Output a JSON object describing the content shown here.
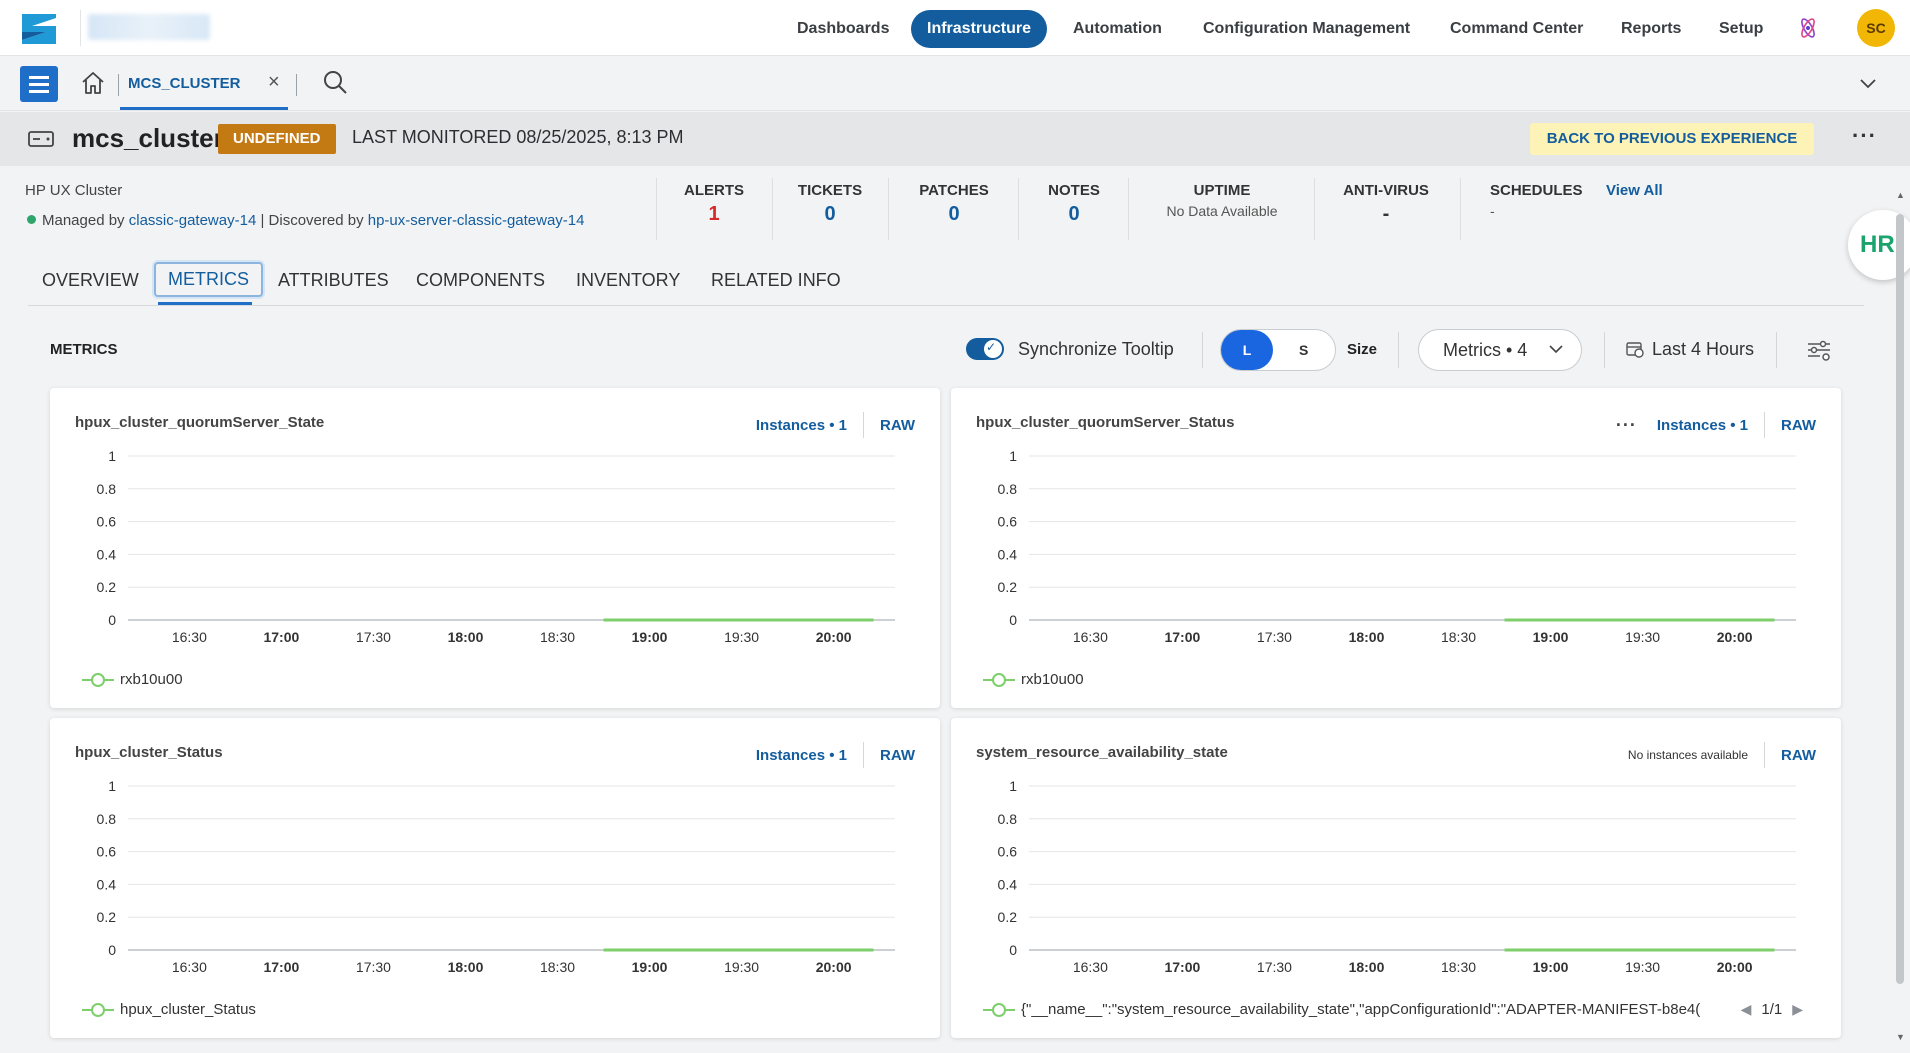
{
  "topnav": {
    "items": [
      {
        "label": "Dashboards"
      },
      {
        "label": "Infrastructure",
        "active": true
      },
      {
        "label": "Automation"
      },
      {
        "label": "Configuration Management"
      },
      {
        "label": "Command Center"
      },
      {
        "label": "Reports"
      },
      {
        "label": "Setup"
      }
    ],
    "avatar": "SC",
    "accent": "#135d9e"
  },
  "tabstrip": {
    "open_tab": "MCS_CLUSTER",
    "close_glyph": "×"
  },
  "header": {
    "title": "mcs_cluster",
    "badge": "UNDEFINED",
    "last_monitored": "LAST MONITORED 08/25/2025, 8:13 PM",
    "back_button": "BACK TO PREVIOUS EXPERIENCE",
    "kebab": "···"
  },
  "summary": {
    "device_type": "HP UX Cluster",
    "managed_prefix": "Managed by",
    "managed_by": "classic-gateway-14",
    "discovered_prefix": "| Discovered by",
    "discovered_by": "hp-ux-server-classic-gateway-14",
    "stats": {
      "alerts": {
        "label": "ALERTS",
        "value": "1"
      },
      "tickets": {
        "label": "TICKETS",
        "value": "0"
      },
      "patches": {
        "label": "PATCHES",
        "value": "0"
      },
      "notes": {
        "label": "NOTES",
        "value": "0"
      },
      "uptime": {
        "label": "UPTIME",
        "value": "No Data Available"
      },
      "antivirus": {
        "label": "ANTI-VIRUS",
        "value": "-"
      },
      "schedules": {
        "label": "SCHEDULES",
        "value": "-"
      }
    },
    "view_all": "View All"
  },
  "hr_bubble": "HR",
  "tabs": [
    {
      "label": "OVERVIEW"
    },
    {
      "label": "METRICS",
      "active": true
    },
    {
      "label": "ATTRIBUTES"
    },
    {
      "label": "COMPONENTS"
    },
    {
      "label": "INVENTORY"
    },
    {
      "label": "RELATED INFO"
    }
  ],
  "metrics_bar": {
    "title": "METRICS",
    "sync_tooltip": "Synchronize Tooltip",
    "sync_enabled": true,
    "size_l": "L",
    "size_s": "S",
    "size_label": "Size",
    "metrics_dropdown": "Metrics • 4",
    "time_range": "Last 4 Hours"
  },
  "panels": [
    {
      "title": "hpux_cluster_quorumServer_State",
      "instances": "Instances • 1",
      "raw": "RAW",
      "legend": "rxb10u00"
    },
    {
      "title": "hpux_cluster_quorumServer_Status",
      "instances": "Instances • 1",
      "raw": "RAW",
      "legend": "rxb10u00",
      "more": "···"
    },
    {
      "title": "hpux_cluster_Status",
      "instances": "Instances • 1",
      "raw": "RAW",
      "legend": "hpux_cluster_Status"
    },
    {
      "title": "system_resource_availability_state",
      "no_instances": "No instances available",
      "raw": "RAW",
      "legend": "{\"__name__\":\"system_resource_availability_state\",\"appConfigurationId\":\"ADAPTER-MANIFEST-b8e4(",
      "pager": "1/1"
    }
  ],
  "chart_data": [
    {
      "type": "line",
      "x_ticks": [
        "16:30",
        "17:00",
        "17:30",
        "18:00",
        "18:30",
        "19:00",
        "19:30",
        "20:00"
      ],
      "y_ticks": [
        "1",
        "0.8",
        "0.6",
        "0.4",
        "0.2",
        "0"
      ],
      "ylim": [
        0,
        1
      ],
      "series": [
        {
          "name": "rxb10u00",
          "color": "#7ccf6a",
          "x_start": "18:45",
          "x_end": "20:13",
          "value": 0
        }
      ]
    },
    {
      "type": "line",
      "x_ticks": [
        "16:30",
        "17:00",
        "17:30",
        "18:00",
        "18:30",
        "19:00",
        "19:30",
        "20:00"
      ],
      "y_ticks": [
        "1",
        "0.8",
        "0.6",
        "0.4",
        "0.2",
        "0"
      ],
      "ylim": [
        0,
        1
      ],
      "series": [
        {
          "name": "rxb10u00",
          "color": "#7ccf6a",
          "x_start": "18:45",
          "x_end": "20:13",
          "value": 0
        }
      ]
    },
    {
      "type": "line",
      "x_ticks": [
        "16:30",
        "17:00",
        "17:30",
        "18:00",
        "18:30",
        "19:00",
        "19:30",
        "20:00"
      ],
      "y_ticks": [
        "1",
        "0.8",
        "0.6",
        "0.4",
        "0.2",
        "0"
      ],
      "ylim": [
        0,
        1
      ],
      "series": [
        {
          "name": "hpux_cluster_Status",
          "color": "#7ccf6a",
          "x_start": "18:45",
          "x_end": "20:13",
          "value": 0
        }
      ]
    },
    {
      "type": "line",
      "x_ticks": [
        "16:30",
        "17:00",
        "17:30",
        "18:00",
        "18:30",
        "19:00",
        "19:30",
        "20:00"
      ],
      "y_ticks": [
        "1",
        "0.8",
        "0.6",
        "0.4",
        "0.2",
        "0"
      ],
      "ylim": [
        0,
        1
      ],
      "series": [
        {
          "color": "#7ccf6a",
          "x_start": "18:45",
          "x_end": "20:13",
          "value": 0
        }
      ]
    }
  ]
}
